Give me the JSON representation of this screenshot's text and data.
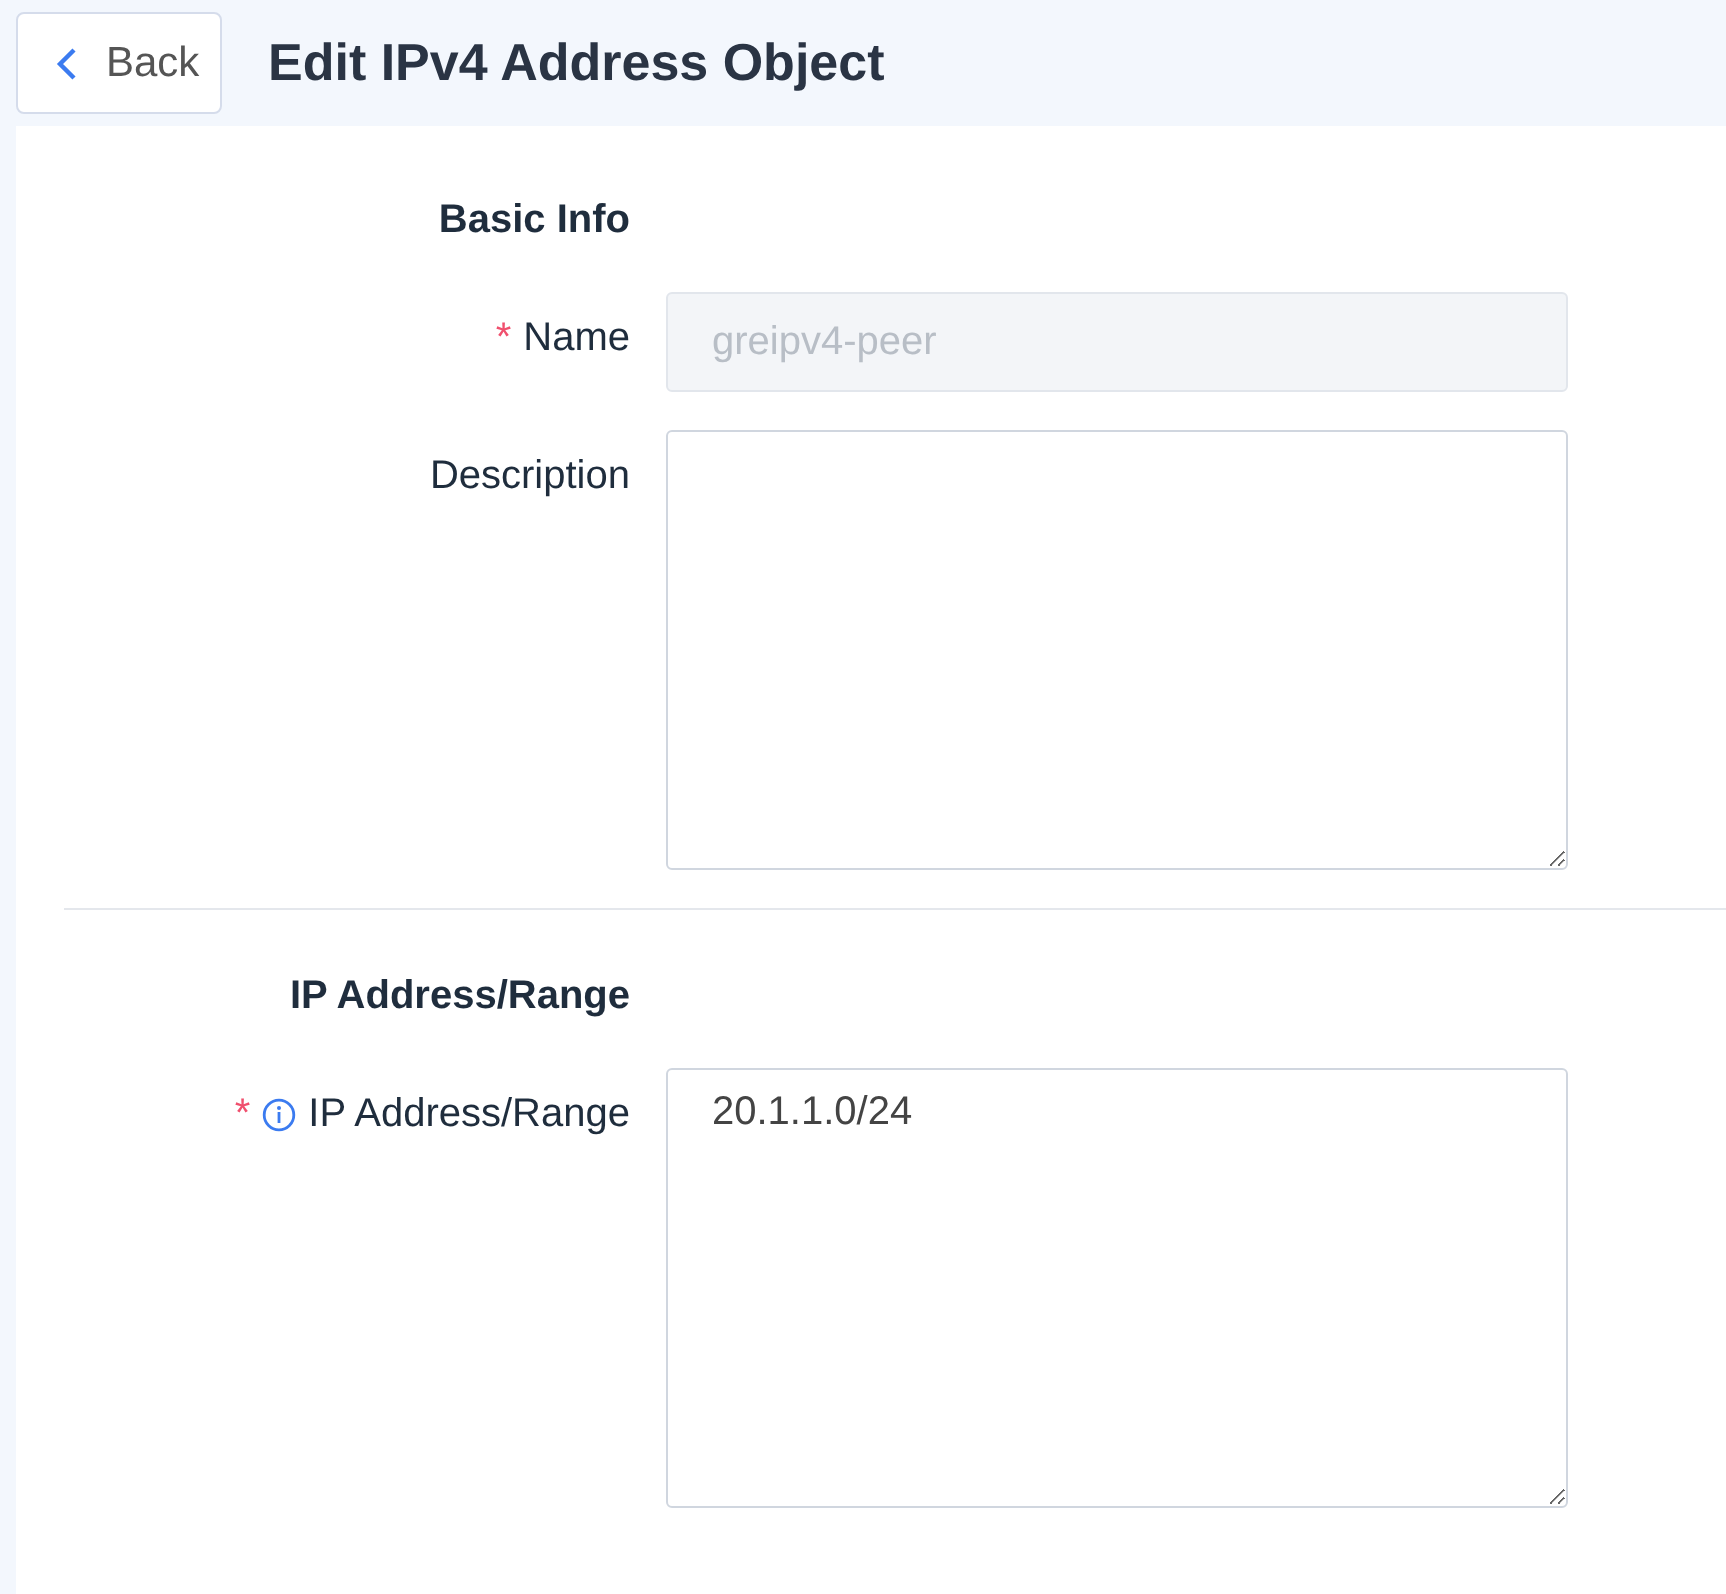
{
  "header": {
    "back_label": "Back",
    "title": "Edit IPv4 Address Object"
  },
  "sections": [
    {
      "heading": "Basic Info",
      "fields": [
        {
          "label": "Name",
          "kind": "input",
          "required_mark": "*",
          "info": false,
          "disabled": true,
          "value": "greipv4-peer"
        },
        {
          "label": "Description",
          "kind": "textarea",
          "info": false,
          "disabled": false
        }
      ]
    },
    {
      "heading": "IP Address/Range",
      "fields": [
        {
          "label": "IP Address/Range",
          "kind": "textarea",
          "required_mark": "*",
          "info": true,
          "disabled": false,
          "value": "20.1.1.0/24"
        }
      ]
    }
  ]
}
